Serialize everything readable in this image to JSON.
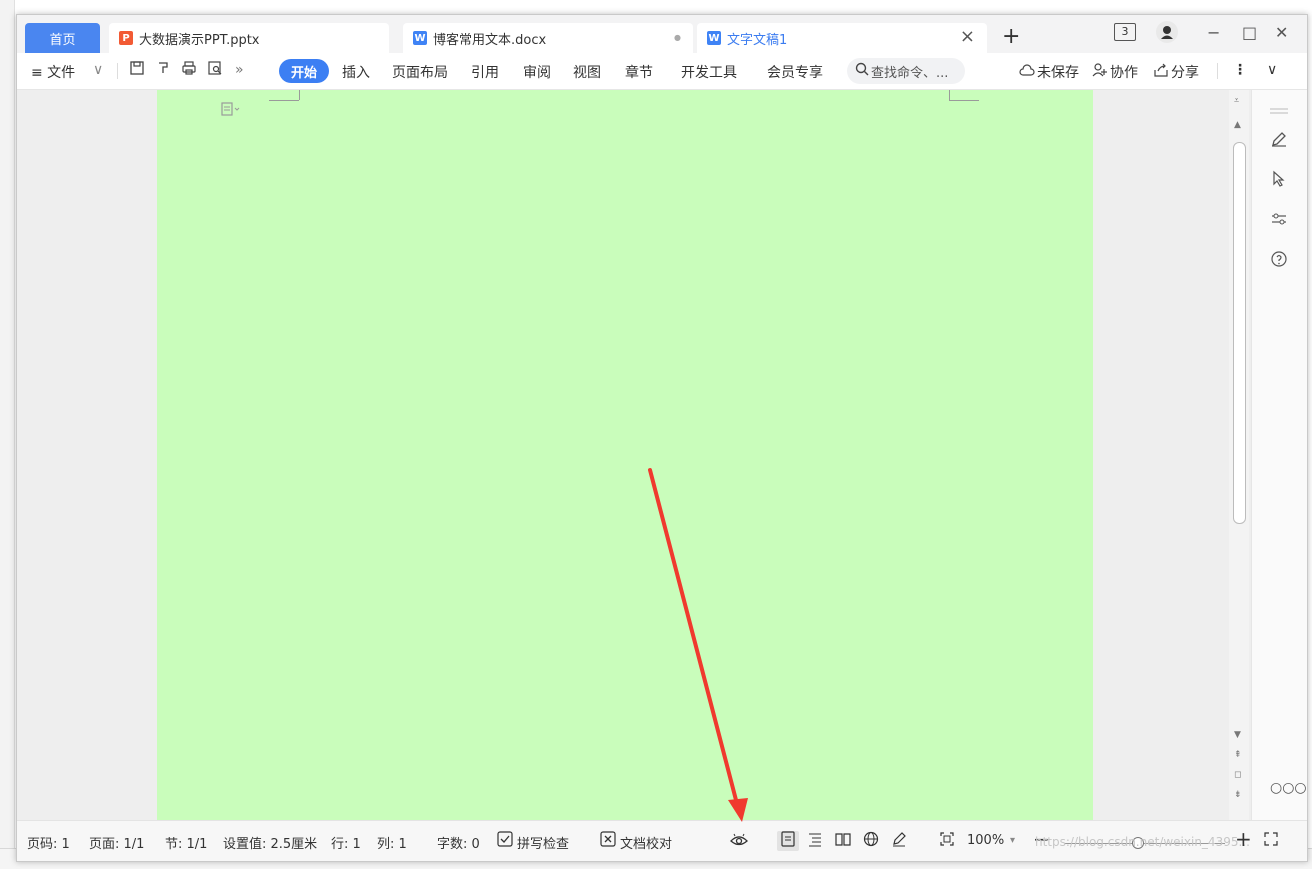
{
  "tabs": {
    "home": "首页",
    "t1": "大数据演示PPT.pptx",
    "t2": "博客常用文本.docx",
    "t3": "文字文稿1",
    "t1_icon": "P",
    "t2_icon": "W",
    "t3_icon": "W",
    "add": "+",
    "close": "×",
    "dot": "●"
  },
  "window": {
    "counter": "3",
    "minimize": "−",
    "maximize": "□",
    "close": "✕"
  },
  "toolbar": {
    "file": "≡ 文件",
    "start": "开始",
    "insert": "插入",
    "layout": "页面布局",
    "reference": "引用",
    "review": "审阅",
    "view": "视图",
    "chapter": "章节",
    "devtools": "开发工具",
    "member": "会员专享",
    "search_placeholder": "查找命令、...",
    "unsaved": "未保存",
    "collab": "协作",
    "share": "分享",
    "more": "⋮",
    "collapse": "∨"
  },
  "status": {
    "page_code": "页码: 1",
    "page": "页面: 1/1",
    "section": "节: 1/1",
    "setting": "设置值: 2.5厘米",
    "row": "行: 1",
    "col": "列: 1",
    "words": "字数: 0",
    "spell": "拼写检查",
    "proof": "文档校对",
    "zoom": "100%",
    "zoom_minus": "−",
    "zoom_plus": "+",
    "watermark": "https://blog.csdn.net/weixin_4395..."
  },
  "colors": {
    "page_bg": "#c9fdbb",
    "accent": "#3c7ff3",
    "arrow": "#f03a2e"
  }
}
